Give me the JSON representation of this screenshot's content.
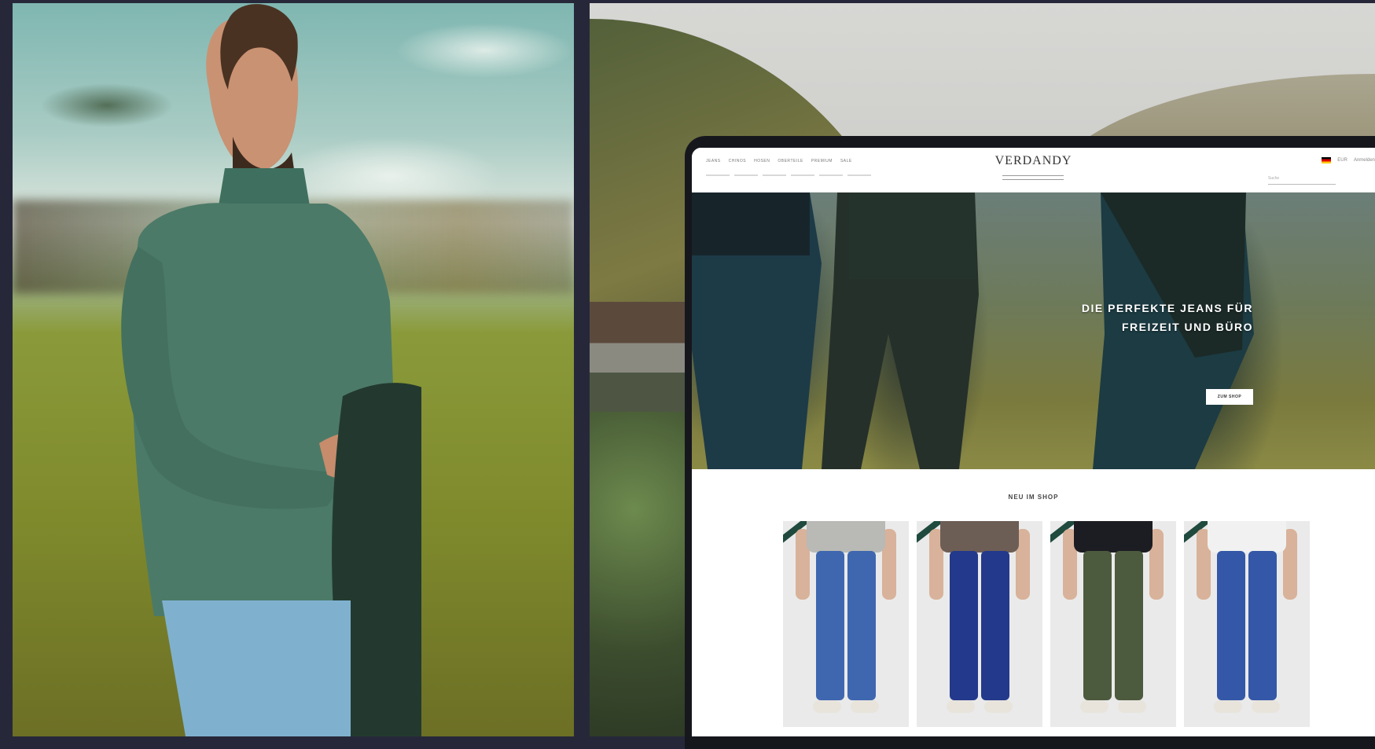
{
  "site": {
    "logo": "VERDANDY",
    "nav": [
      "JEANS",
      "CHINOS",
      "HOSEN",
      "OBERTEILE",
      "PREMIUM",
      "SALE"
    ],
    "currency": "EUR",
    "account": "Anmelden",
    "search_placeholder": "Suche"
  },
  "hero": {
    "title_line1": "DIE PERFEKTE JEANS FÜR",
    "title_line2": "FREIZEIT UND BÜRO",
    "button_label": "ZUM SHOP"
  },
  "section": {
    "title": "NEU IM SHOP"
  },
  "products": [
    {
      "top_color": "#b9b9b5",
      "jeans_color": "#3f67b0"
    },
    {
      "top_color": "#6d5e55",
      "jeans_color": "#23398b"
    },
    {
      "top_color": "#1c1d22",
      "jeans_color": "#4c5a3e"
    },
    {
      "top_color": "#f1f1f1",
      "jeans_color": "#3458a7"
    }
  ],
  "colors": {
    "page_background": "#26283a",
    "badge": "#1f4a3d"
  }
}
